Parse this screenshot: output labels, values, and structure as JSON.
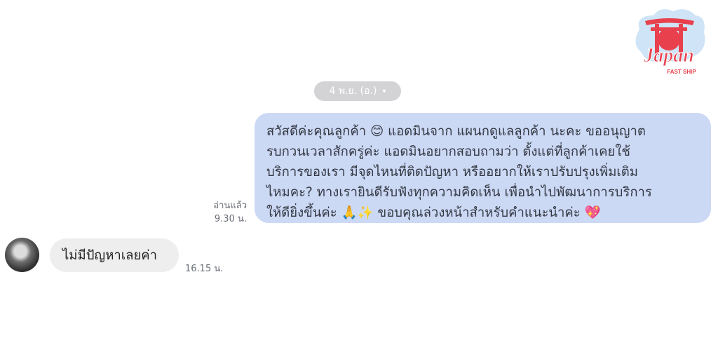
{
  "logo": {
    "title": "Japan",
    "subtitle": "FAST SHIP"
  },
  "date_separator": {
    "label": "4 พ.ย. (อ.)",
    "caret": "▾"
  },
  "outgoing_message": {
    "lines": [
      "สวัสดีค่ะคุณลูกค้า 😊 แอดมินจาก แผนกดูแลลูกค้า นะคะ ขออนุญาต",
      "รบกวนเวลาสักครู่ค่ะ แอดมินอยากสอบถามว่า ตั้งแต่ที่ลูกค้าเคยใช้",
      "บริการของเรา มีจุดไหนที่ติดปัญหา หรืออยากให้เราปรับปรุงเพิ่มเติม",
      "ไหมคะ? ทางเรายินดีรับฟังทุกความคิดเห็น เพื่อนำไปพัฒนาการบริการ",
      "ให้ดียิ่งขึ้นค่ะ 🙏✨ ขอบคุณล่วงหน้าสำหรับคำแนะนำค่ะ 💖"
    ],
    "read_label": "อ่านแล้ว",
    "time": "9.30 น."
  },
  "incoming_message": {
    "avatar_icon": "user-avatar-blurred",
    "text": "ไม่มีปัญหาเลยค่า",
    "time": "16.15 น."
  }
}
